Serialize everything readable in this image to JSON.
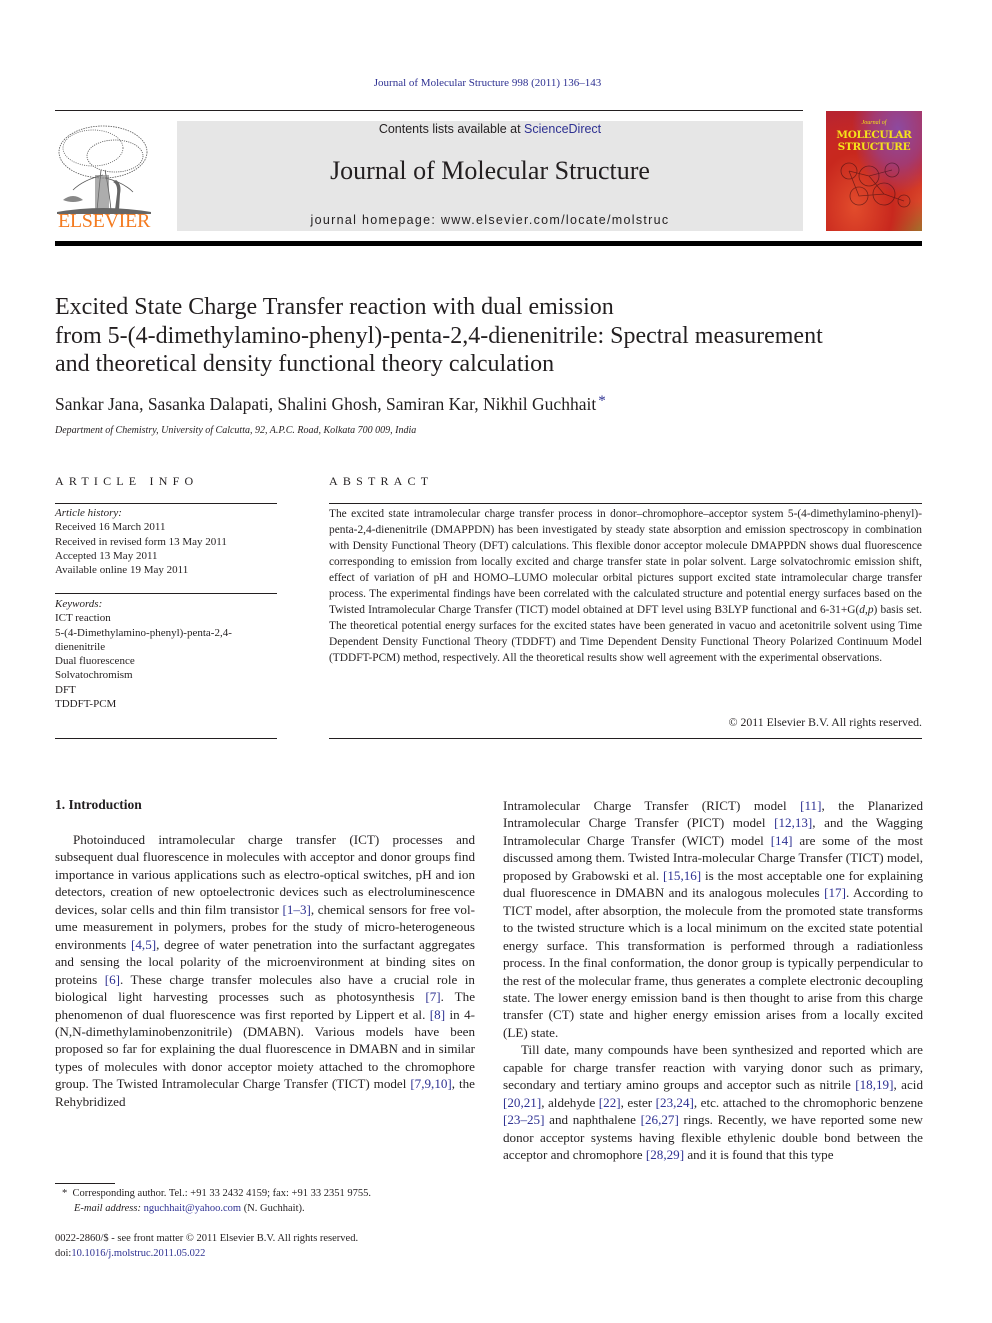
{
  "running_head": "Journal of Molecular Structure 998 (2011) 136–143",
  "header": {
    "publisher_name": "ELSEVIER",
    "contents_prefix": "Contents lists available at ",
    "contents_link": "ScienceDirect",
    "journal_title": "Journal of Molecular Structure",
    "homepage_line": "journal homepage: www.elsevier.com/locate/molstruc",
    "cover_pretitle": "Journal of",
    "cover_title_line1": "MOLECULAR",
    "cover_title_line2": "STRUCTURE"
  },
  "article": {
    "title": "Excited State Charge Transfer reaction with dual emission from 5-(4-dimethylamino-phenyl)-penta-2,4-dienenitrile: Spectral measurement and theoretical density functional theory calculation",
    "title_lines": [
      "Excited State Charge Transfer reaction with dual emission",
      "from 5-(4-dimethylamino-phenyl)-penta-2,4-dienenitrile: Spectral measurement",
      "and theoretical density functional theory calculation"
    ],
    "authors": "Sankar Jana, Sasanka Dalapati, Shalini Ghosh, Samiran Kar, Nikhil Guchhait",
    "corresponding_mark": "*",
    "affiliation": "Department of Chemistry, University of Calcutta, 92, A.P.C. Road, Kolkata 700 009, India"
  },
  "article_info": {
    "heading": "ARTICLE INFO",
    "history_label": "Article history:",
    "history": [
      "Received 16 March 2011",
      "Received in revised form 13 May 2011",
      "Accepted 13 May 2011",
      "Available online 19 May 2011"
    ],
    "keywords_label": "Keywords:",
    "keywords": [
      "ICT reaction",
      "5-(4-Dimethylamino-phenyl)-penta-2,4-dienenitrile",
      "Dual fluorescence",
      "Solvatochromism",
      "DFT",
      "TDDFT-PCM"
    ]
  },
  "abstract": {
    "heading": "ABSTRACT",
    "text_part1": "The excited state intramolecular charge transfer process in donor–chromophore–acceptor system 5-(4-dimethylamino-phenyl)-penta-2,4-dienenitrile (DMAPPDN) has been investigated by steady state absorption and emission spectroscopy in combination with Density Functional Theory (DFT) calculations. This flexible donor acceptor molecule DMAPPDN shows dual fluorescence corresponding to emission from locally excited and charge transfer state in polar solvent. Large solvatochromic emission shift, effect of variation of pH and HOMO–LUMO molecular orbital pictures support excited state intramolecular charge transfer process. The experimental findings have been correlated with the calculated structure and potential energy surfaces based on the Twisted Intramolecular Charge Transfer (TICT) model obtained at DFT level using B3LYP functional and 6-31+G(",
    "text_italic1": "d",
    "text_comma": ",",
    "text_italic2": "p",
    "text_part2": ") basis set. The theoretical potential energy surfaces for the excited states have been generated in vacuo and acetonitrile solvent using Time Dependent Density Functional Theory (TDDFT) and Time Dependent Density Functional Theory Polarized Continuum Model (TDDFT-PCM) method, respectively. All the theoretical results show well agreement with the experimental observations.",
    "copyright": "© 2011 Elsevier B.V. All rights reserved."
  },
  "introduction": {
    "heading": "1. Introduction",
    "p1": [
      {
        "t": "Photoinduced intramolecular charge transfer (ICT) processes and subsequent dual fluorescence in molecules with acceptor and donor groups find importance in various applications such as electro-optical switches, pH and ion detectors, creation of new optoelectronic devices such as electroluminescence devices, solar cells and thin film transistor "
      },
      {
        "r": "[1–3]"
      },
      {
        "t": ", chemical sensors for free vol­ume measurement in polymers, probes for the study of micro-het­erogeneous environments "
      },
      {
        "r": "[4,5]"
      },
      {
        "t": ", degree of water penetration into the surfactant aggregates and sensing the local polarity of the microenvironment at binding sites on proteins "
      },
      {
        "r": "[6]"
      },
      {
        "t": ". These charge transfer molecules also have a crucial role in biological light har­vesting processes such as photosynthesis "
      },
      {
        "r": "[7]"
      },
      {
        "t": ". The phenomenon of dual fluorescence was first reported by Lippert et al. "
      },
      {
        "r": "[8]"
      },
      {
        "t": " in 4-(N,N-dimethylaminobenzonitrile) (DMABN). Various models have been proposed so far for explaining the dual fluorescence in DMABN and in similar types of molecules with donor acceptor moiety attached to the chromophore group. The Twisted Intramo­lecular Charge Transfer (TICT) model "
      },
      {
        "r": "[7,9,10]"
      },
      {
        "t": ", the Rehybridized Intramolecular Charge Transfer (RICT) model "
      },
      {
        "r": "[11]"
      },
      {
        "t": ", the Planarized Intramolecular Charge Transfer (PICT) model "
      },
      {
        "r": "[12,13]"
      },
      {
        "t": ", and the Wag­ging Intramolecular Charge Transfer (WICT) model "
      },
      {
        "r": "[14]"
      },
      {
        "t": " are some of the most discussed among them. Twisted Intra-molecular Charge Transfer (TICT) model, proposed by Grabowski et al. "
      },
      {
        "r": "[15,16]"
      },
      {
        "t": " is the most acceptable one for explaining dual fluorescence in DMABN and its analogous molecules "
      },
      {
        "r": "[17]"
      },
      {
        "t": ". According to TICT model, after absorption, the molecule from the promoted state transforms to the twisted structure which is a local minimum on the excited state potential energy surface. This transformation is performed through a radiationless process. In the final conforma­tion, the donor group is typically perpendicular to the rest of the molecular frame, thus generates a complete electronic decoupling state. The lower energy emission band is then thought to arise from this charge transfer (CT) state and higher energy emission arises from a locally excited (LE) state."
      }
    ],
    "p2": [
      {
        "t": "Till date, many compounds have been synthesized and reported which are capable for charge transfer reaction with varying donor such as primary, secondary and tertiary amino groups and acceptor such as nitrile "
      },
      {
        "r": "[18,19]"
      },
      {
        "t": ", acid "
      },
      {
        "r": "[20,21]"
      },
      {
        "t": ", aldehyde "
      },
      {
        "r": "[22]"
      },
      {
        "t": ", ester "
      },
      {
        "r": "[23,24]"
      },
      {
        "t": ", etc. attached to the chromophoric benzene "
      },
      {
        "r": "[23–25]"
      },
      {
        "t": " and naphtha­lene "
      },
      {
        "r": "[26,27]"
      },
      {
        "t": " rings. Recently, we have reported some new donor acceptor systems having flexible ethylenic double bond between the acceptor and chromophore "
      },
      {
        "r": "[28,29]"
      },
      {
        "t": " and it is found that this type"
      }
    ]
  },
  "footnote": {
    "mark": "*",
    "line1": "Corresponding author. Tel.: +91 33 2432 4159; fax: +91 33 2351 9755.",
    "email_label": "E-mail address:",
    "email": "nguchhait@yahoo.com",
    "email_suffix": " (N. Guchhait)."
  },
  "issn": {
    "line1": "0022-2860/$ - see front matter © 2011 Elsevier B.V. All rights reserved.",
    "doi_label": "doi:",
    "doi": "10.1016/j.molstruc.2011.05.022"
  },
  "colors": {
    "link": "#2e3192",
    "elsevier_orange": "#f47b20",
    "banner_gray": "#e6e6e6",
    "cover_title_yellow": "#f5e31a"
  }
}
